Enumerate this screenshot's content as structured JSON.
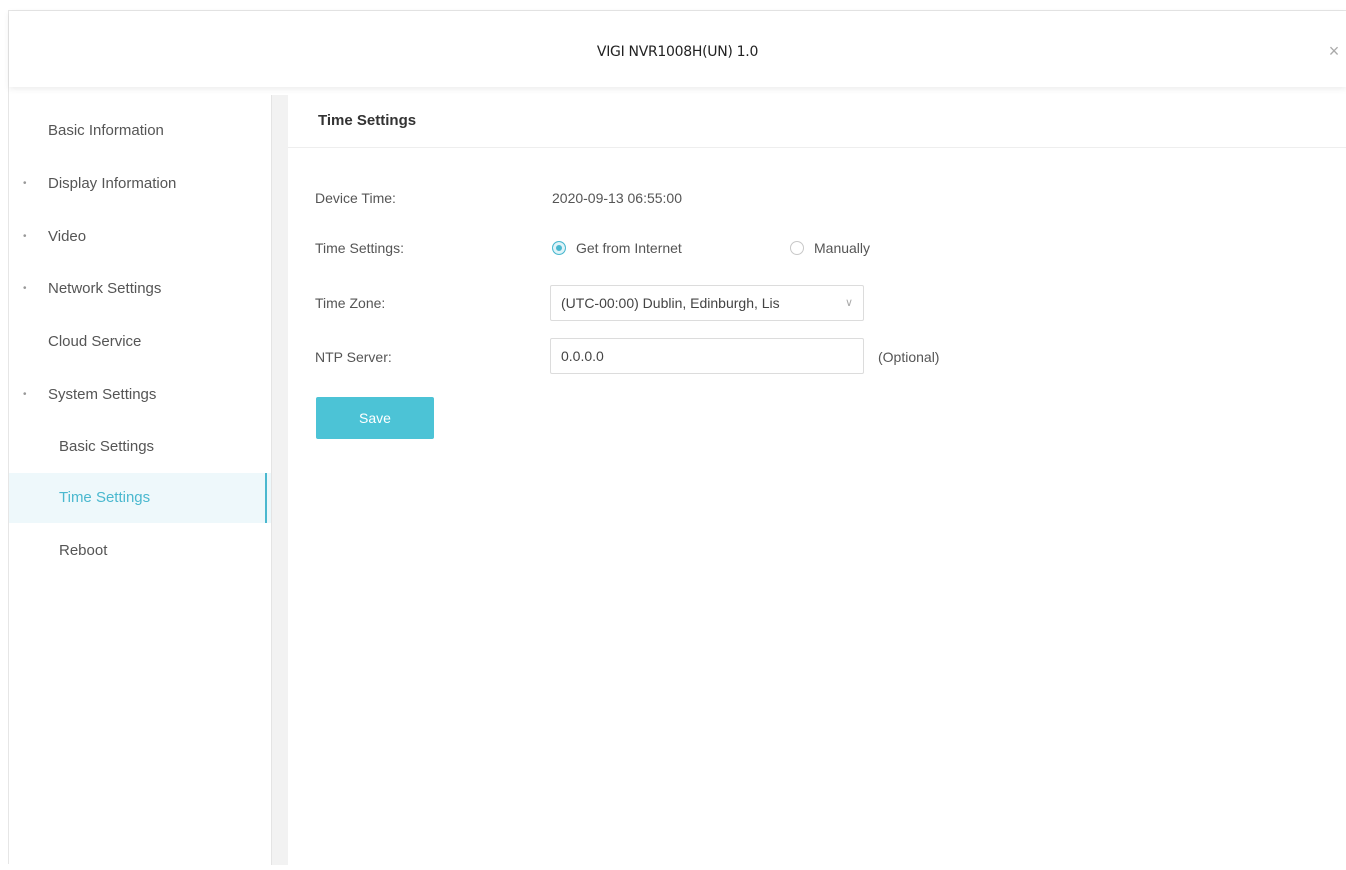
{
  "window": {
    "title": "VIGI NVR1008H(UN) 1.0",
    "close_glyph": "×",
    "close_icon": "close-icon"
  },
  "sidebar": {
    "items": [
      {
        "label": "Basic Information",
        "bullet": ""
      },
      {
        "label": "Display Information",
        "bullet": "•"
      },
      {
        "label": "Video",
        "bullet": "•"
      },
      {
        "label": "Network Settings",
        "bullet": "•"
      },
      {
        "label": "Cloud Service",
        "bullet": ""
      },
      {
        "label": "System Settings",
        "bullet": "•"
      },
      {
        "label": "Basic Settings",
        "bullet": ""
      },
      {
        "label": "Time Settings",
        "bullet": ""
      },
      {
        "label": "Reboot",
        "bullet": ""
      }
    ],
    "active_item": "Time Settings"
  },
  "main": {
    "title": "Time Settings",
    "device_time": {
      "label": "Device Time:",
      "value": "2020-09-13 06:55:00"
    },
    "time_settings": {
      "label": "Time Settings:",
      "options": [
        "Get from Internet",
        "Manually"
      ],
      "selected": "Get from Internet"
    },
    "time_zone": {
      "label": "Time Zone:",
      "value": "(UTC-00:00) Dublin, Edinburgh, Lis"
    },
    "ntp_server": {
      "label": "NTP Server:",
      "value": "0.0.0.0",
      "hint": "(Optional)"
    },
    "save_label": "Save"
  },
  "colors": {
    "accent": "#4ab8cf",
    "button": "#4cc3d6",
    "active_bg": "#eef8fb"
  }
}
